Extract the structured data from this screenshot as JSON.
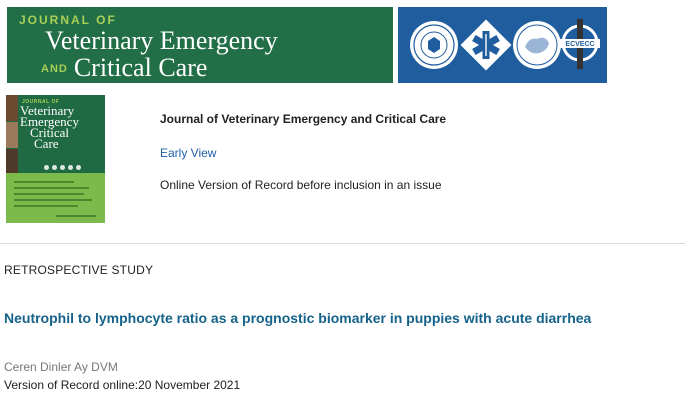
{
  "banner": {
    "line1": "JOURNAL OF",
    "line2": "Veterinary Emergency",
    "and": "AND",
    "line3": "Critical Care",
    "badge_text": "ECVECC",
    "colors": {
      "green": "#216e47",
      "lime": "#a9cf57",
      "blue": "#1f5d9e"
    },
    "icons": [
      "society-seal-icon",
      "star-of-life-icon",
      "europe-map-seal-icon",
      "ecvecc-logo-icon"
    ]
  },
  "cover": {
    "small_title": "JOURNAL OF",
    "title_lines": [
      "Veterinary",
      "Emergency",
      "Critical",
      "Care"
    ]
  },
  "journal": {
    "name": "Journal of Veterinary Emergency and Critical Care",
    "early_view": "Early View",
    "vor_note": "Online Version of Record before inclusion in an issue"
  },
  "article": {
    "type": "RETROSPECTIVE STUDY",
    "title": "Neutrophil to lymphocyte ratio as a prognostic biomarker in puppies with acute diarrhea",
    "author": "Ceren Dinler Ay DVM",
    "vor_date": "Version of Record online:20 November 2021",
    "link_color": "#15628a"
  }
}
